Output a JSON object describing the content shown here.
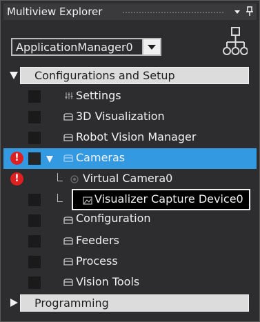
{
  "panel": {
    "title": "Multiview Explorer",
    "dropdown_icon": "chevron-down-icon",
    "pin_icon": "pin-icon"
  },
  "toolbar": {
    "selected_project": "ApplicationManager0",
    "hierarchy_icon": "hierarchy-icon"
  },
  "tree": {
    "configurations": "Configurations and Setup",
    "settings": "Settings",
    "visualization_3d": "3D Visualization",
    "robot_vision_manager": "Robot Vision Manager",
    "cameras": "Cameras",
    "virtual_camera": "Virtual Camera0",
    "visualizer_capture": "Visualizer Capture Device0",
    "configuration": "Configuration",
    "feeders": "Feeders",
    "process": "Process",
    "vision_tools": "Vision Tools",
    "programming": "Programming",
    "error_glyph": "!"
  },
  "colors": {
    "background": "#2d2d30",
    "selected_row": "#3399e0",
    "error_badge": "#e02020",
    "header_bar": "#dcdcdc"
  }
}
